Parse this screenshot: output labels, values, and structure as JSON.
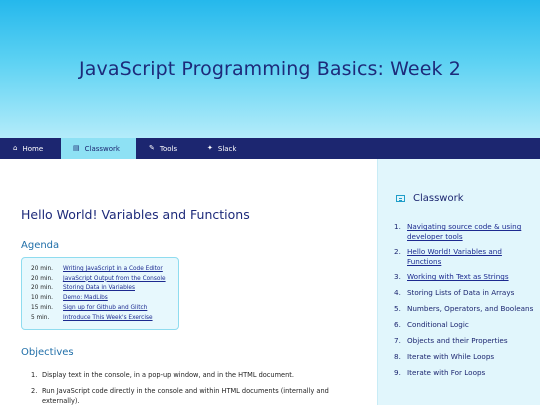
{
  "header": {
    "title": "JavaScript Programming Basics: Week 2"
  },
  "nav": {
    "items": [
      {
        "label": "Home",
        "icon": "home-icon",
        "glyph": "⌂"
      },
      {
        "label": "Classwork",
        "icon": "book-icon",
        "glyph": "▤"
      },
      {
        "label": "Tools",
        "icon": "wrench-icon",
        "glyph": "✎"
      },
      {
        "label": "Slack",
        "icon": "slack-icon",
        "glyph": "✦"
      }
    ],
    "active": "Classwork"
  },
  "lesson": {
    "title": "Hello World! Variables and Functions",
    "agenda_heading": "Agenda",
    "agenda": [
      {
        "time": "20 min.",
        "label": "Writing JavaScript in a Code Editor"
      },
      {
        "time": "20 min.",
        "label": "JavaScript Output from the Console"
      },
      {
        "time": "20 min.",
        "label": "Storing Data in Variables"
      },
      {
        "time": "10 min.",
        "label": "Demo: MadLibs"
      },
      {
        "time": "15 min.",
        "label": "Sign up for Github and Glitch"
      },
      {
        "time": "5 min.",
        "label": "Introduce This Week's Exercise"
      }
    ],
    "objectives_heading": "Objectives",
    "objectives": [
      {
        "num": "1.",
        "text": "Display text in the console, in a pop-up window, and in the HTML document."
      },
      {
        "num": "2.",
        "text": "Run JavaScript code directly in the console and within HTML documents (internally and externally)."
      }
    ]
  },
  "sidebar": {
    "heading": "Classwork",
    "icon": "list-icon",
    "items": [
      {
        "num": "1.",
        "label": "Navigating source code & using developer tools",
        "link": true
      },
      {
        "num": "2.",
        "label": "Hello World! Variables and Functions",
        "link": true
      },
      {
        "num": "3.",
        "label": "Working with Text as Strings",
        "link": true
      },
      {
        "num": "4.",
        "label": "Storing Lists of Data in Arrays",
        "link": false
      },
      {
        "num": "5.",
        "label": "Numbers, Operators, and Booleans",
        "link": false
      },
      {
        "num": "6.",
        "label": "Conditional Logic",
        "link": false
      },
      {
        "num": "7.",
        "label": "Objects and their Properties",
        "link": false
      },
      {
        "num": "8.",
        "label": "Iterate with While Loops",
        "link": false
      },
      {
        "num": "9.",
        "label": "Iterate with For Loops",
        "link": false
      }
    ]
  }
}
